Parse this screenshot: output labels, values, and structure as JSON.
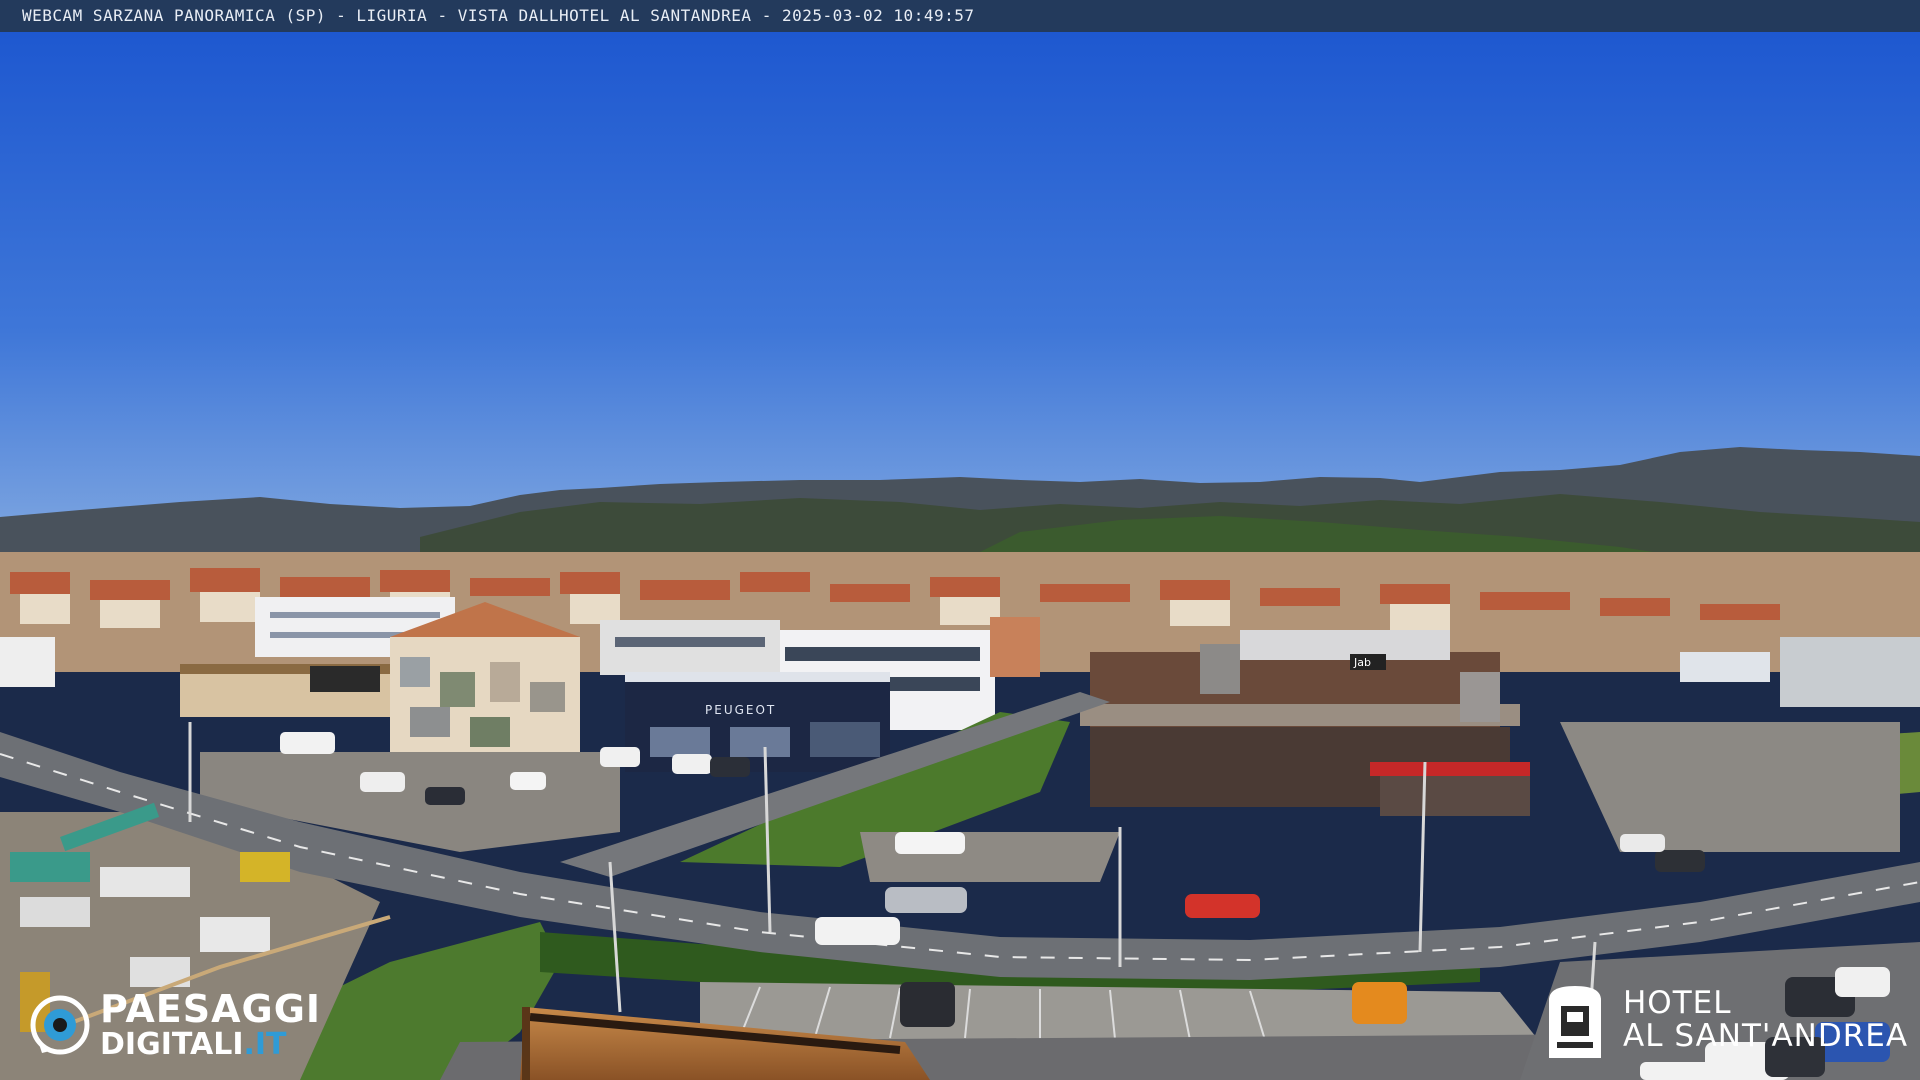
{
  "caption": {
    "text": "WEBCAM SARZANA PANORAMICA (SP) - LIGURIA - VISTA DALLHOTEL AL SANTANDREA - 2025-03-02  10:49:57"
  },
  "scene": {
    "sky_top": "#1e5fd6",
    "sky_bottom": "#5b8fde",
    "mountain_color": "#3c4650",
    "hills_color": "#3e5a34",
    "road_color": "#6b6e72",
    "grass_color": "#4d7a2e"
  },
  "building_signs": {
    "dealer_sign": "PEUGEOT",
    "roof_sign": "Jab"
  },
  "watermark_left": {
    "line1": "PAESAGGI",
    "line2_main": "DIGITALI",
    "line2_suffix": ".IT",
    "icon": "eye-icon",
    "accent": "#2f9bd6"
  },
  "watermark_right": {
    "line1": "HOTEL",
    "line2": "AL SANT'ANDREA",
    "icon": "hotel-badge-icon"
  }
}
